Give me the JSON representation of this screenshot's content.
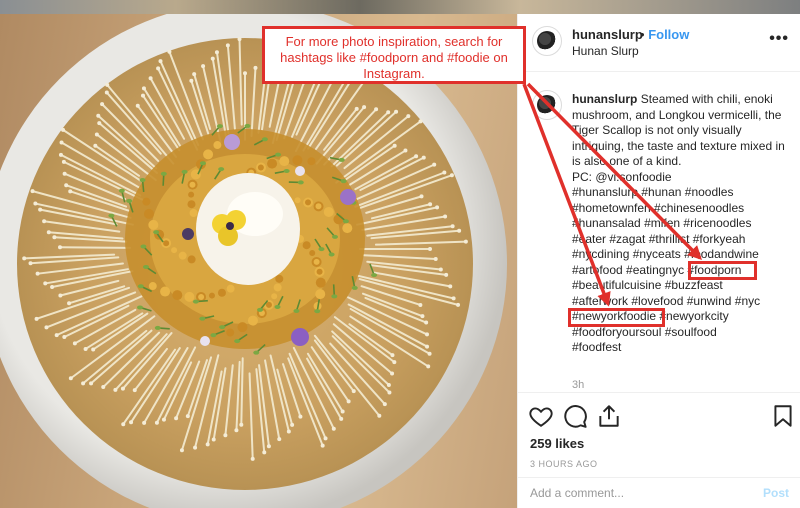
{
  "header": {
    "username": "hunanslurp",
    "separator": "•",
    "follow_label": "Follow",
    "location": "Hunan Slurp",
    "more_label": "•••"
  },
  "caption": {
    "username": "hunanslurp",
    "text": "Steamed with chili, enoki mushroom, and Longkou vermicelli, the Tiger Scallop is not only visually intriguing, the taste and texture mixed in is also one of a kind.",
    "credit": "PC: @vi.sonfoodie",
    "tag_lines": [
      "#hunanslurp #hunan #noodles",
      "#hometownfen #chinesenoodles",
      "#hunansalad #mifen #ricenoodles",
      "#eater #zagat #thrillist #forkyeah",
      "#nycdining #nyceats #foodandwine",
      "#artofood #eatingnyc #foodporn",
      "#beautifulcuisine #buzzfeast",
      "#afterwork #lovefood #unwind #nyc",
      "#newyorkfoodie #newyorkcity",
      "#foodforyoursoul #soulfood",
      "#foodfest"
    ],
    "time_short": "3h"
  },
  "actions": {
    "like_icon": "heart-icon",
    "comment_icon": "comment-icon",
    "share_icon": "share-icon",
    "save_icon": "bookmark-icon",
    "likes": "259 likes",
    "time_ago": "3 HOURS AGO"
  },
  "comment": {
    "placeholder": "Add a comment...",
    "post_label": "Post"
  },
  "annotation": {
    "text": "For more photo inspiration, search for hashtags like #foodporn and #foodie on Instagram.",
    "highlight_1": "#foodporn",
    "highlight_2": "#newyorkfoodie",
    "color": "#e0302b"
  },
  "colors": {
    "link_blue": "#3897f0",
    "post_disabled": "#b2dffc"
  }
}
